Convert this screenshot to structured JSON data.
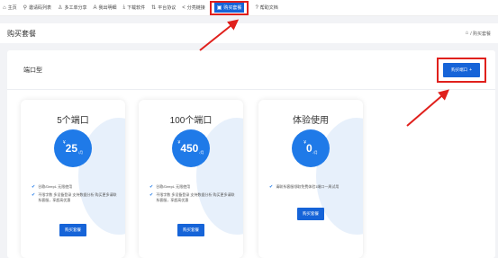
{
  "nav": [
    {
      "label": "主页",
      "icon": "home-icon",
      "glyph": "⌂"
    },
    {
      "label": "邀请码列表",
      "icon": "pin-icon",
      "glyph": "⚲"
    },
    {
      "label": "多工单分享",
      "icon": "user-icon",
      "glyph": "♙"
    },
    {
      "label": "我出明细",
      "icon": "translate-icon",
      "glyph": "A"
    },
    {
      "label": "下载软件",
      "icon": "download-icon",
      "glyph": "⤓"
    },
    {
      "label": "平台协议",
      "icon": "transfer-icon",
      "glyph": "⇅"
    },
    {
      "label": "分亮链接",
      "icon": "share-icon",
      "glyph": "<"
    },
    {
      "label": "购买套餐",
      "icon": "package-icon",
      "glyph": "▣",
      "active": true
    },
    {
      "label": "帮助文档",
      "icon": "help-icon",
      "glyph": "?"
    }
  ],
  "page": {
    "title": "购买套餐",
    "breadcrumb": "/ 购买套餐"
  },
  "panel": {
    "title": "端口型",
    "buy_port_label": "购买端口",
    "buy_port_icon": "+"
  },
  "plans": [
    {
      "name": "5个端口",
      "currency": "¥",
      "amount": "25",
      "unit": "/月",
      "features": [
        "谷歌/DeepL 无限使用",
        "不限字数 多设备登录 支持数据分析 购买更多请联系客服，享超高优惠"
      ],
      "button": "购买套餐"
    },
    {
      "name": "100个端口",
      "currency": "¥",
      "amount": "450",
      "unit": "/月",
      "features": [
        "谷歌/DeepL 无限使用",
        "不限字数 多设备登录 支持数据分析 购买更多请联系客服，享超高优惠"
      ],
      "button": "购买套餐"
    },
    {
      "name": "体验使用",
      "currency": "¥",
      "amount": "0",
      "unit": "/月",
      "features": [
        "请联系客服领取免费体验1端口一周试用"
      ],
      "button": "购买套餐"
    }
  ],
  "colors": {
    "primary": "#1664d8",
    "highlight": "#e0201c",
    "price_circle": "#1f7ae8"
  }
}
